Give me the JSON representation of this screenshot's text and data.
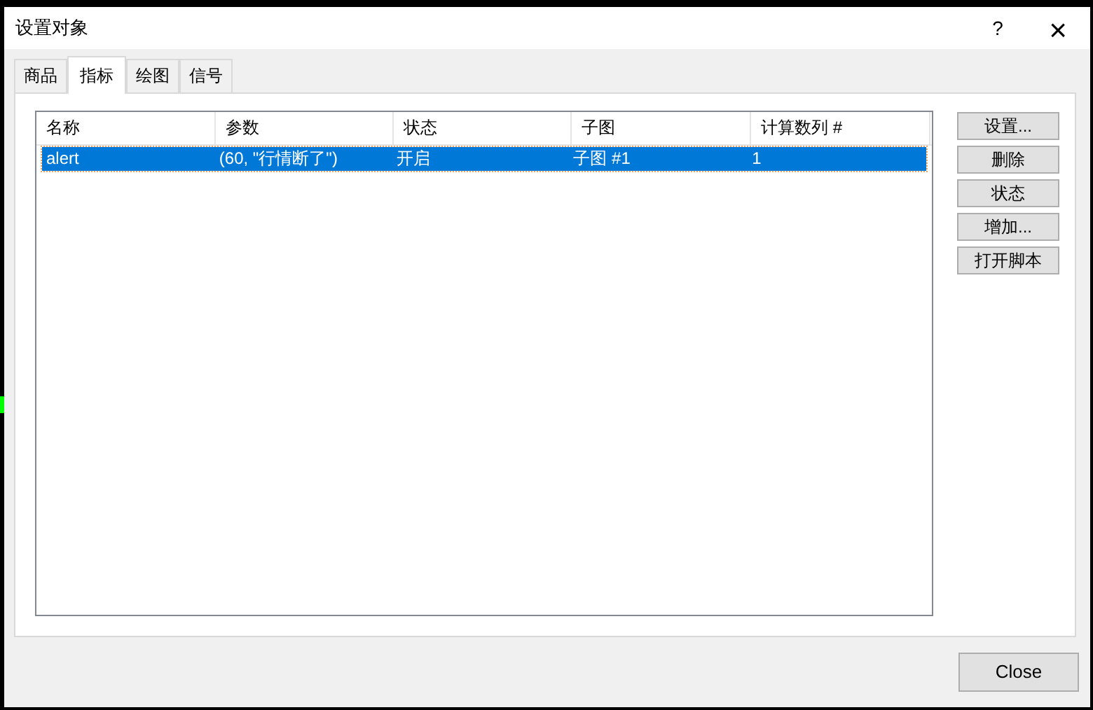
{
  "window": {
    "title": "设置对象",
    "help": "?",
    "close": "×"
  },
  "tabs": [
    {
      "label": "商品",
      "selected": false
    },
    {
      "label": "指标",
      "selected": true
    },
    {
      "label": "绘图",
      "selected": false
    },
    {
      "label": "信号",
      "selected": false
    }
  ],
  "table": {
    "columns": [
      "名称",
      "参数",
      "状态",
      "子图",
      "计算数列 #"
    ],
    "rows": [
      {
        "cells": [
          "alert",
          "(60, \"行情断了\")",
          "开启",
          "子图 #1",
          "1"
        ],
        "selected": true
      }
    ]
  },
  "side_buttons": [
    "设置...",
    "删除",
    "状态",
    "增加...",
    "打开脚本"
  ],
  "footer_button": "Close"
}
